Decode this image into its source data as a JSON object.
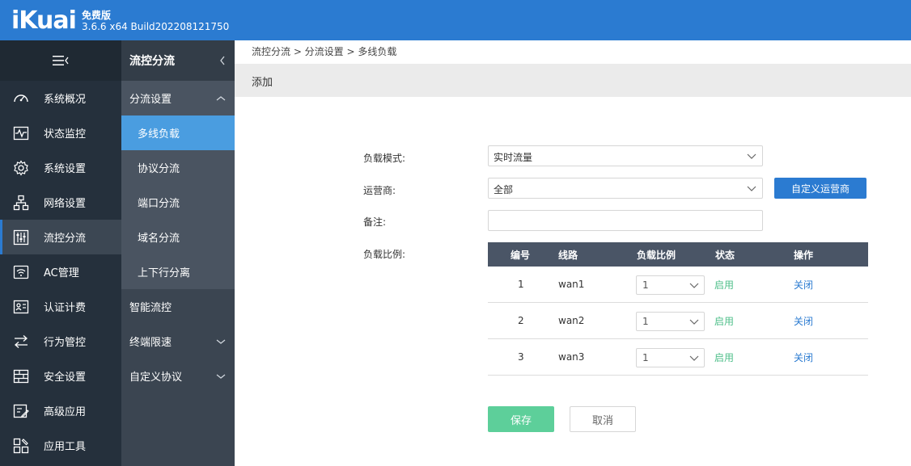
{
  "header": {
    "logo": "iKuai",
    "edition": "免费版",
    "version": "3.6.6 x64 Build202208121750"
  },
  "nav": {
    "items": [
      {
        "label": "系统概况",
        "icon": "dashboard-icon"
      },
      {
        "label": "状态监控",
        "icon": "monitor-icon"
      },
      {
        "label": "系统设置",
        "icon": "gear-icon"
      },
      {
        "label": "网络设置",
        "icon": "network-icon"
      },
      {
        "label": "流控分流",
        "icon": "sliders-icon",
        "active": true
      },
      {
        "label": "AC管理",
        "icon": "wifi-icon"
      },
      {
        "label": "认证计费",
        "icon": "id-card-icon"
      },
      {
        "label": "行为管控",
        "icon": "arrows-icon"
      },
      {
        "label": "安全设置",
        "icon": "firewall-icon"
      },
      {
        "label": "高级应用",
        "icon": "edit-icon"
      },
      {
        "label": "应用工具",
        "icon": "tools-icon"
      }
    ]
  },
  "subnav": {
    "title": "流控分流",
    "group_open": "分流设置",
    "subitems": [
      "多线负载",
      "协议分流",
      "端口分流",
      "域名分流",
      "上下行分离"
    ],
    "group_smart": "智能流控",
    "group_terminal": "终端限速",
    "group_custom": "自定义协议"
  },
  "breadcrumb": "流控分流 > 分流设置 > 多线负载",
  "page_title": "添加",
  "form": {
    "mode_label": "负载模式:",
    "mode_value": "实时流量",
    "isp_label": "运营商:",
    "isp_value": "全部",
    "custom_isp_button": "自定义运营商",
    "remark_label": "备注:",
    "remark_value": "",
    "ratio_label": "负载比例:"
  },
  "table": {
    "headers": [
      "编号",
      "线路",
      "负载比例",
      "状态",
      "操作"
    ],
    "rows": [
      {
        "id": "1",
        "line": "wan1",
        "ratio": "1",
        "status": "启用",
        "action": "关闭"
      },
      {
        "id": "2",
        "line": "wan2",
        "ratio": "1",
        "status": "启用",
        "action": "关闭"
      },
      {
        "id": "3",
        "line": "wan3",
        "ratio": "1",
        "status": "启用",
        "action": "关闭"
      }
    ]
  },
  "buttons": {
    "save": "保存",
    "cancel": "取消"
  },
  "colors": {
    "header_blue": "#2b7bd1",
    "save_green": "#5dcf9a",
    "status_green": "#4fbf8a"
  }
}
